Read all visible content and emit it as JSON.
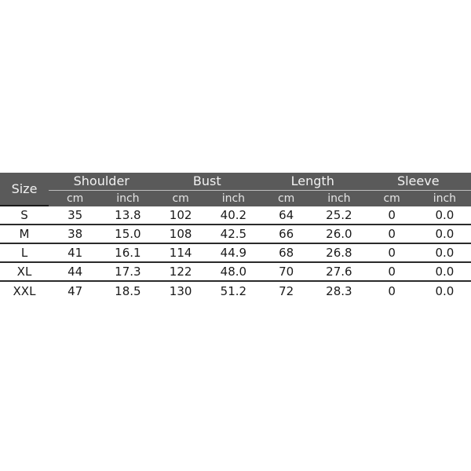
{
  "table": {
    "size_label": "Size",
    "groups": [
      "Shoulder",
      "Bust",
      "Length",
      "Sleeve"
    ],
    "units": [
      "cm",
      "inch",
      "cm",
      "inch",
      "cm",
      "inch",
      "cm",
      "inch"
    ],
    "rows": [
      {
        "size": "S",
        "values": [
          "35",
          "13.8",
          "102",
          "40.2",
          "64",
          "25.2",
          "0",
          "0.0"
        ]
      },
      {
        "size": "M",
        "values": [
          "38",
          "15.0",
          "108",
          "42.5",
          "66",
          "26.0",
          "0",
          "0.0"
        ]
      },
      {
        "size": "L",
        "values": [
          "41",
          "16.1",
          "114",
          "44.9",
          "68",
          "26.8",
          "0",
          "0.0"
        ]
      },
      {
        "size": "XL",
        "values": [
          "44",
          "17.3",
          "122",
          "48.0",
          "70",
          "27.6",
          "0",
          "0.0"
        ]
      },
      {
        "size": "XXL",
        "values": [
          "47",
          "18.5",
          "130",
          "51.2",
          "72",
          "28.3",
          "0",
          "0.0"
        ]
      }
    ]
  }
}
